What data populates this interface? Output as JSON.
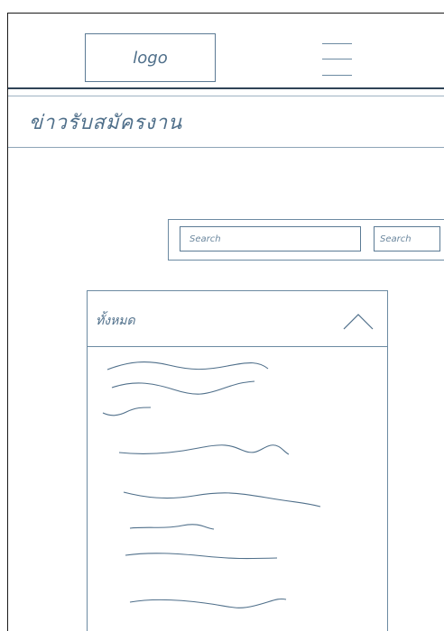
{
  "header": {
    "logo_text": "logo",
    "menu_icon": "hamburger-menu-icon"
  },
  "page": {
    "title": "ข่าวรับสมัครงาน"
  },
  "search": {
    "placeholder": "Search",
    "button_label": "Search"
  },
  "category_panel": {
    "selected_label": "ทั้งหมด",
    "toggle_icon": "chevron-up-icon",
    "items_note": "scribbled placeholder lines (unreadable)"
  },
  "colors": {
    "ink": "#4f6f8a",
    "rule_dark": "#2f4457",
    "rule_light": "#9fb3c3",
    "background": "#ffffff"
  }
}
